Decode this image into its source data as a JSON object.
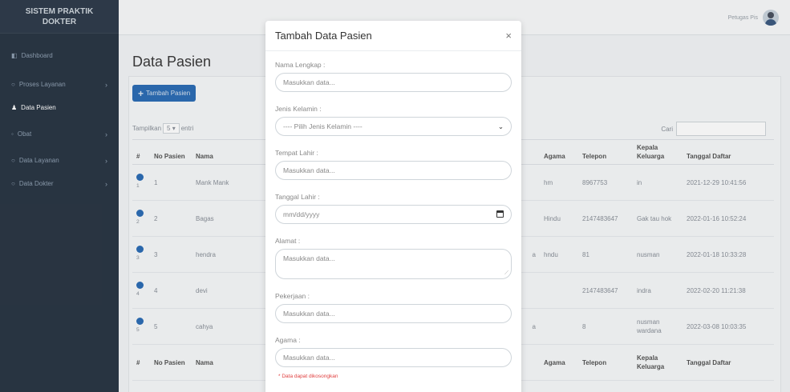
{
  "sidebar": {
    "brand_line1": "SISTEM PRAKTIK",
    "brand_line2": "DOKTER",
    "items": [
      {
        "label": "Dashboard",
        "chevron": ""
      },
      {
        "label": "Proses Layanan",
        "chevron": "›"
      },
      {
        "label": "Data Pasien",
        "chevron": ""
      },
      {
        "label": "Obat",
        "chevron": "›"
      },
      {
        "label": "Data Layanan",
        "chevron": "›"
      },
      {
        "label": "Data Dokter",
        "chevron": "›"
      }
    ]
  },
  "topbar": {
    "user": "Petugas Pis"
  },
  "page": {
    "title": "Data Pasien",
    "add_button": "Tambah Pasien",
    "show_prefix": "Tampilkan",
    "show_value": "5",
    "show_suffix": "entri",
    "search_label": "Cari"
  },
  "table": {
    "headers": [
      "#",
      "No Pasien",
      "Nama",
      "",
      "Agama",
      "Telepon",
      "Kepala Keluarga",
      "Tanggal Daftar"
    ],
    "rows": [
      {
        "num": "1",
        "no": "1",
        "nama": "Mank Mank",
        "x": "",
        "agama": "hm",
        "telp": "8967753",
        "kk": "in",
        "tgl": "2021-12-29 10:41:56"
      },
      {
        "num": "2",
        "no": "2",
        "nama": "Bagas",
        "x": "",
        "agama": "Hindu",
        "telp": "2147483647",
        "kk": "Gak tau hok",
        "tgl": "2022-01-16 10:52:24"
      },
      {
        "num": "3",
        "no": "3",
        "nama": "hendra",
        "x": "a",
        "agama": "hndu",
        "telp": "81",
        "kk": "nusman",
        "tgl": "2022-01-18 10:33:28"
      },
      {
        "num": "4",
        "no": "4",
        "nama": "devi",
        "x": "",
        "agama": "",
        "telp": "2147483647",
        "kk": "indra",
        "tgl": "2022-02-20 11:21:38"
      },
      {
        "num": "5",
        "no": "5",
        "nama": "cahya",
        "x": "a",
        "agama": "",
        "telp": "8",
        "kk": "nusman wardana",
        "tgl": "2022-03-08 10:03:35"
      }
    ]
  },
  "modal": {
    "title": "Tambah Data Pasien",
    "close": "×",
    "fields": {
      "nama": {
        "label": "Nama Lengkap :",
        "placeholder": "Masukkan data..."
      },
      "jk": {
        "label": "Jenis Kelamin :",
        "placeholder": "---- Pilih Jenis Kelamin ----"
      },
      "tempat": {
        "label": "Tempat Lahir :",
        "placeholder": "Masukkan data..."
      },
      "tgl": {
        "label": "Tanggal Lahir :",
        "placeholder": "mm/dd/yyyy"
      },
      "alamat": {
        "label": "Alamat :",
        "placeholder": "Masukkan data..."
      },
      "kerja": {
        "label": "Pekerjaan :",
        "placeholder": "Masukkan data..."
      },
      "agama": {
        "label": "Agama :",
        "placeholder": "Masukkan data..."
      }
    },
    "note": "* Data dapat dikosongkan"
  }
}
